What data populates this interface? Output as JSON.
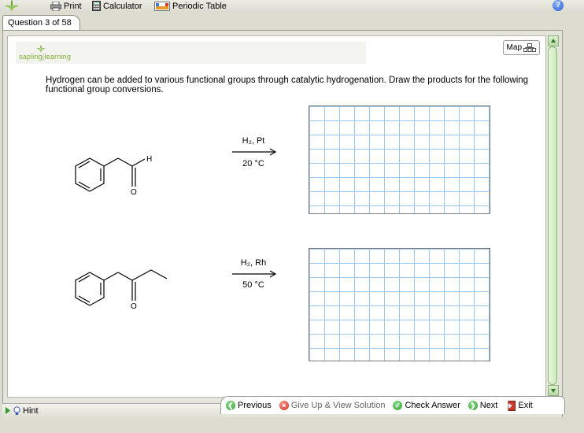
{
  "toolbar": {
    "print_label": "Print",
    "calculator_label": "Calculator",
    "periodic_label": "Periodic Table",
    "help_label": "?"
  },
  "tab": {
    "label": "Question 3 of 58"
  },
  "brand": {
    "name_left": "sapling",
    "name_right": "learning"
  },
  "map": {
    "label": "Map"
  },
  "question": {
    "text": "Hydrogen can be added to various functional groups through catalytic hydrogenation. Draw the products for the following functional group conversions."
  },
  "reactions": [
    {
      "reagent": "H₂, Pt",
      "condition": "20 °C",
      "atom_h": "H",
      "atom_o": "O"
    },
    {
      "reagent": "H₂, Rh",
      "condition": "50 °C",
      "atom_o": "O"
    }
  ],
  "footer": {
    "hint_label": "Hint",
    "previous_label": "Previous",
    "giveup_label": "Give Up & View Solution",
    "check_label": "Check Answer",
    "next_label": "Next",
    "exit_label": "Exit"
  }
}
